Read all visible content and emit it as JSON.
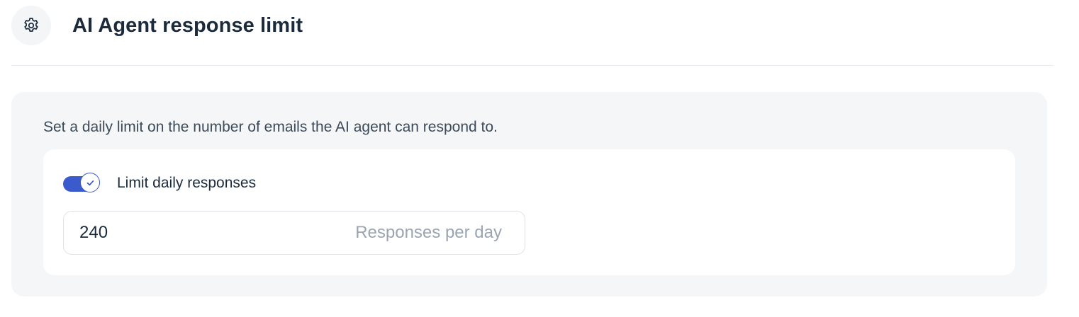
{
  "header": {
    "title": "AI Agent response limit",
    "icon": "gear-icon"
  },
  "settings": {
    "description": "Set a daily limit on the number of emails the AI agent can respond to.",
    "toggle": {
      "label": "Limit daily responses",
      "checked": true,
      "icon": "check-icon"
    },
    "limit_input": {
      "value": "240",
      "suffix": "Responses per day"
    }
  },
  "colors": {
    "accent": "#3b5bcc",
    "title_text": "#1c2b3c",
    "panel_bg": "#f4f6f8"
  }
}
